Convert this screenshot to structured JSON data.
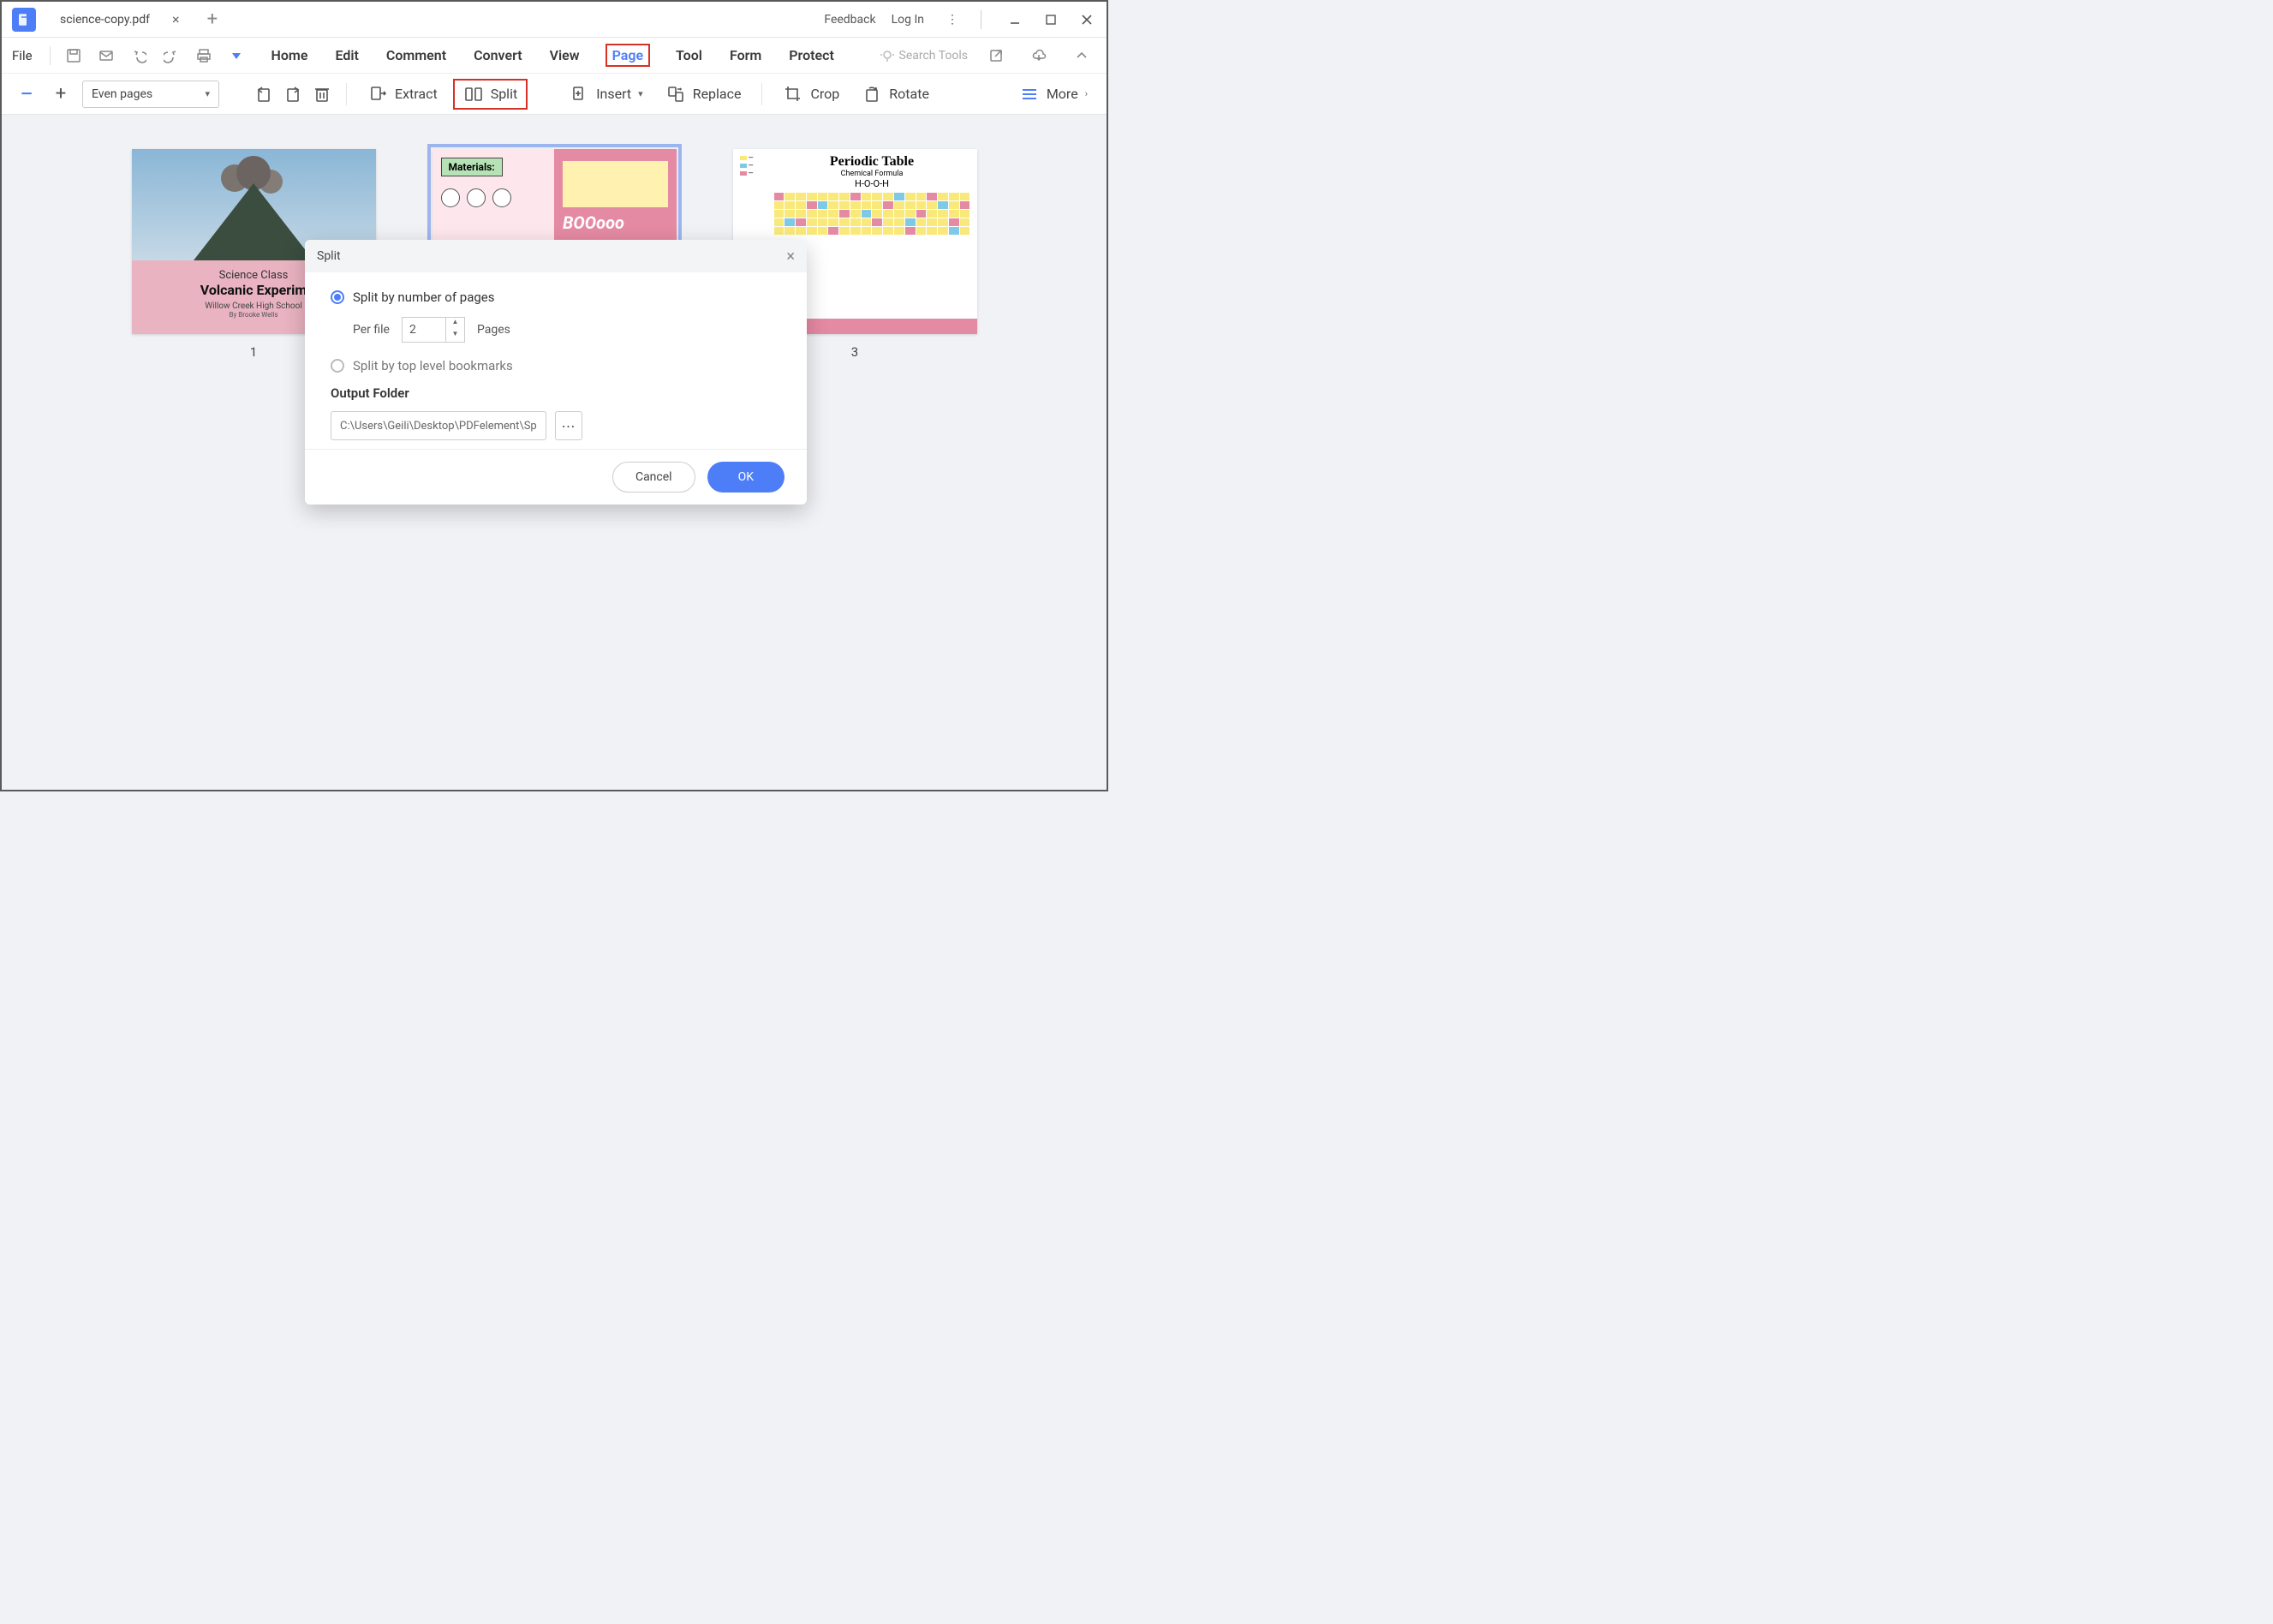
{
  "tab": {
    "title": "science-copy.pdf"
  },
  "titlebar": {
    "feedback": "Feedback",
    "login": "Log In"
  },
  "menubar": {
    "file": "File",
    "items": [
      "Home",
      "Edit",
      "Comment",
      "Convert",
      "View",
      "Page",
      "Tool",
      "Form",
      "Protect"
    ],
    "active_index": 5,
    "search_placeholder": "Search Tools"
  },
  "toolbar": {
    "select_value": "Even pages",
    "extract": "Extract",
    "split": "Split",
    "insert": "Insert",
    "replace": "Replace",
    "crop": "Crop",
    "rotate": "Rotate",
    "more": "More"
  },
  "thumbs": {
    "n1": "1",
    "n3": "3",
    "t1": {
      "l1": "Science Class",
      "l2": "Volcanic Experim",
      "l3": "Willow Creek High School",
      "l4": "By Brooke Wells"
    },
    "t2": {
      "tag": "Materials:",
      "boo": "BOOooo"
    },
    "t3": {
      "title": "Periodic Table",
      "sub": "Chemical Formula",
      "formula": "H-O-O-H"
    }
  },
  "dialog": {
    "title": "Split",
    "opt1": "Split by number of pages",
    "perfile": "Per file",
    "perfile_value": "2",
    "pages": "Pages",
    "opt2": "Split by top level bookmarks",
    "output_label": "Output Folder",
    "output_path": "C:\\Users\\Geili\\Desktop\\PDFelement\\Sp",
    "cancel": "Cancel",
    "ok": "OK"
  }
}
